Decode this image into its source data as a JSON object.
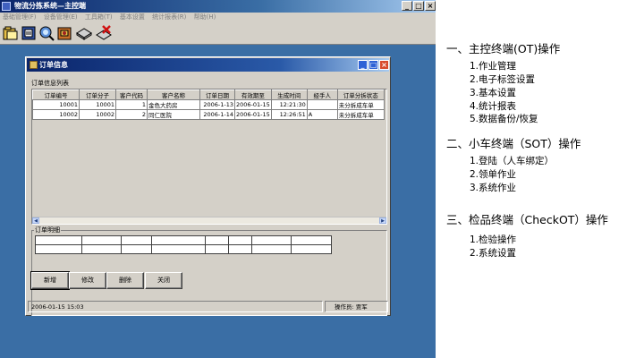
{
  "app": {
    "title": "物流分拣系统—主控端",
    "menu": [
      "基础管理(F)",
      "设备管理(E)",
      "工具箱(T)",
      "基本设置",
      "统计报表(R)",
      "帮助(H)"
    ],
    "controls": {
      "minimize": "_",
      "maximize": "□",
      "close": "×"
    },
    "toolbar_icons": [
      "folder-icon",
      "document-icon",
      "magnifier-icon",
      "archive-icon",
      "database-icon",
      "delete-icon"
    ]
  },
  "order_window": {
    "title": "订单信息",
    "list_label": "订单信息列表",
    "columns": [
      "订单编号",
      "订单分子",
      "客户代码",
      "客户名称",
      "订单日期",
      "有效期至",
      "生成时间",
      "经手人",
      "订单分拆状态"
    ],
    "rows": [
      [
        "10001",
        "10001",
        "1",
        "金色大药房",
        "2006-1-13",
        "2006-01-15",
        "12:21:30",
        "",
        "未分拆成车单"
      ],
      [
        "10002",
        "10002",
        "2",
        "同仁医院",
        "2006-1-14",
        "2006-01-15",
        "12:26:51",
        "A",
        "未分拆成车单"
      ]
    ],
    "detail_label": "订单明细",
    "buttons": {
      "add": "新增",
      "edit": "修改",
      "delete": "删除",
      "close": "关闭"
    },
    "status": {
      "date": "2006-01-15 15:03",
      "operator": "操作员: 贾军"
    }
  },
  "outline": {
    "sections": [
      {
        "title": "一、主控终端(OT)操作",
        "items": [
          "1.作业管理",
          "2.电子标签设置",
          "3.基本设置",
          "4.统计报表",
          "5.数据备份/恢复"
        ]
      },
      {
        "title": "二、小车终端（SOT）操作",
        "items": [
          "1.登陆（人车绑定）",
          "2.领单作业",
          "3.系统作业"
        ]
      },
      {
        "title": "三、检品终端（CheckOT）操作",
        "items": [
          "1.检验操作",
          "2.系统设置"
        ]
      }
    ]
  },
  "colors": {
    "desktop": "#3a6ea5",
    "titlebar": "#0a246a",
    "face": "#d4d0c8"
  }
}
